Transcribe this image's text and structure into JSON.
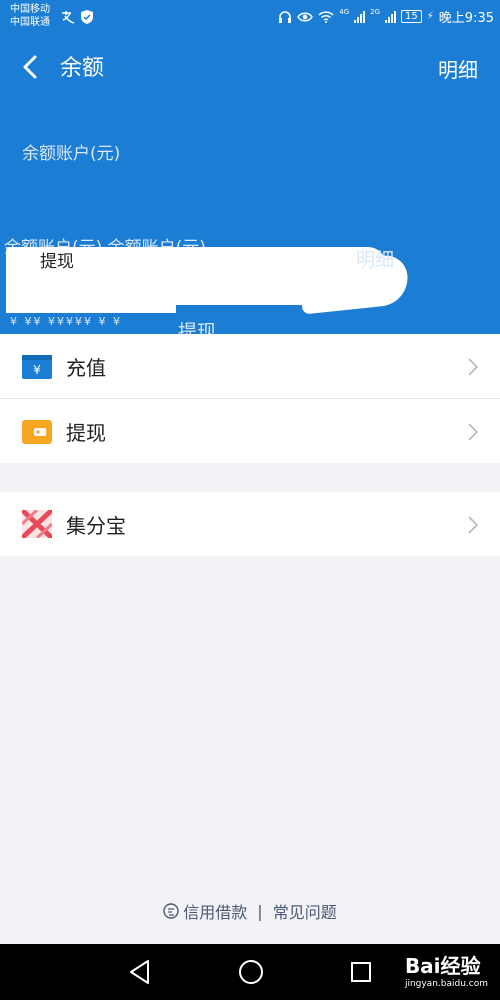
{
  "status_bar": {
    "carrier_1": "中国移动",
    "carrier_2": "中国联通",
    "net_1": "4G",
    "net_2": "2G",
    "battery": "15",
    "time": "晚上9:35"
  },
  "header": {
    "title": "余额",
    "detail_link": "明细",
    "account_label": "余额账户(元)",
    "smear_line_1": "余额账户(元)  余额账户(元)",
    "smear_label": "提现",
    "smear_detail": "明细",
    "smear_bottom": "提现",
    "smear_symbols": "¥ ¥¥ ¥¥¥¥¥ ¥ ¥"
  },
  "menu": {
    "items": [
      {
        "label": "充值",
        "icon": "recharge-icon",
        "color": "#1c7dd4"
      },
      {
        "label": "提现",
        "icon": "withdraw-wallet-icon",
        "color": "#f5a623"
      }
    ],
    "extra": [
      {
        "label": "集分宝",
        "icon": "jifenbao-icon",
        "color": "#e64b5a"
      }
    ]
  },
  "footer": {
    "credit_loan": "信用借款",
    "separator": "|",
    "faq": "常见问题"
  },
  "watermark": {
    "brand": "Bai经验",
    "site": "jingyan.baidu.com"
  }
}
